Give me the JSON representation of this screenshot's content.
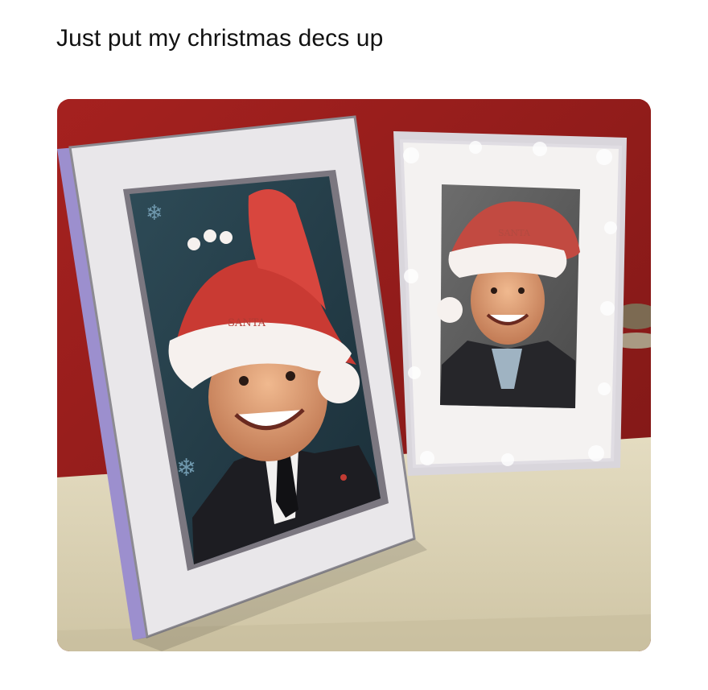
{
  "post": {
    "caption": "Just put my christmas decs up"
  },
  "photo": {
    "description_icon": "photo-image",
    "hat_text_left": "SANTA",
    "hat_text_right": "SANTA"
  },
  "colors": {
    "wall": "#9a1f1d",
    "shelf": "#ddd3b4",
    "frame_left": "#e9e7ea",
    "frame_right": "#f1efee",
    "santa_hat_red": "#c93a33",
    "santa_hat_fur": "#f6f1ee",
    "suit": "#1d1d22"
  }
}
